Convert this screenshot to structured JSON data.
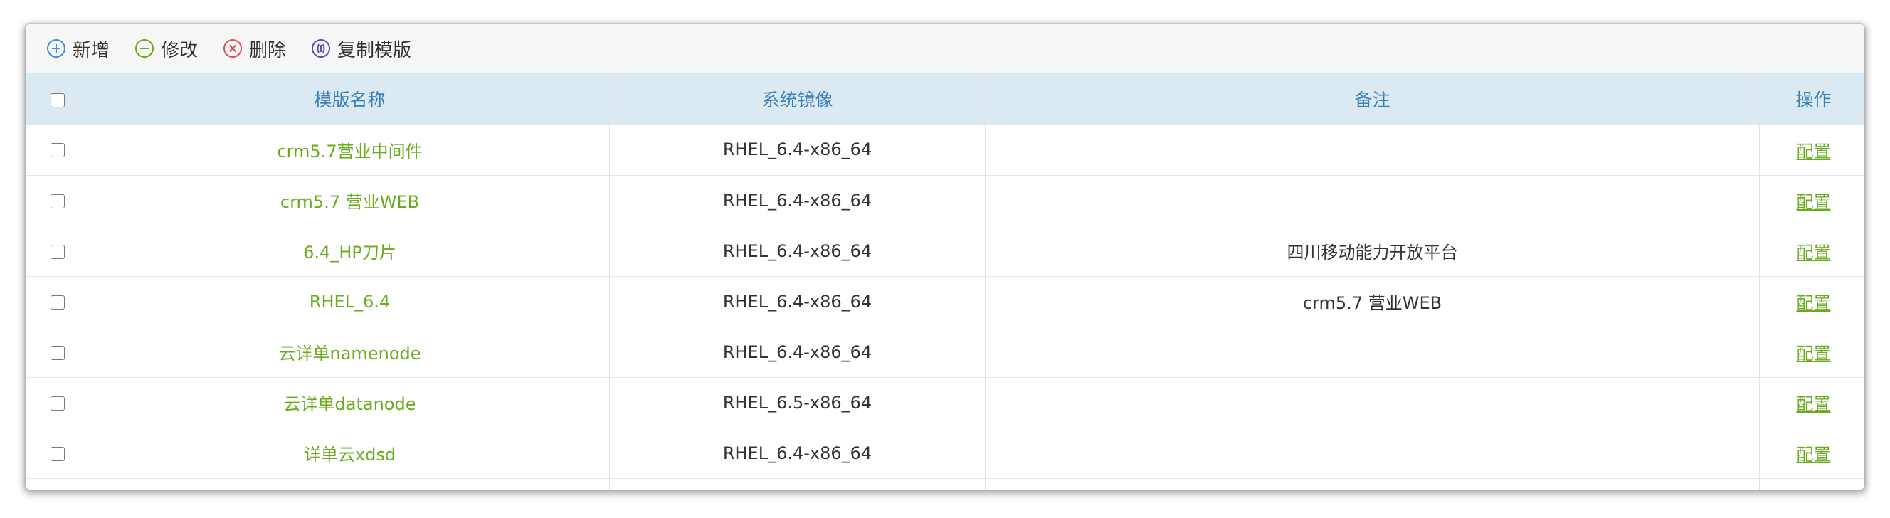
{
  "toolbar": {
    "add_label": "新增",
    "edit_label": "修改",
    "delete_label": "删除",
    "copy_label": "复制模版"
  },
  "colors": {
    "add": "#3b8fd8",
    "edit": "#6aab1e",
    "delete": "#d9534f",
    "copy": "#5b4fa8",
    "header_bg": "#dbe9f3",
    "header_text": "#3a7fb5",
    "link": "#6aab1e"
  },
  "table": {
    "headers": {
      "name": "模版名称",
      "image": "系统镜像",
      "remark": "备注",
      "action": "操作"
    },
    "rows": [
      {
        "name": "crm5.7营业中间件",
        "image": "RHEL_6.4-x86_64",
        "remark": "",
        "action": "配置"
      },
      {
        "name": "crm5.7 营业WEB",
        "image": "RHEL_6.4-x86_64",
        "remark": "",
        "action": "配置"
      },
      {
        "name": "6.4_HP刀片",
        "image": "RHEL_6.4-x86_64",
        "remark": "四川移动能力开放平台",
        "action": "配置"
      },
      {
        "name": "RHEL_6.4",
        "image": "RHEL_6.4-x86_64",
        "remark": "crm5.7 营业WEB",
        "action": "配置"
      },
      {
        "name": "云详单namenode",
        "image": "RHEL_6.4-x86_64",
        "remark": "",
        "action": "配置"
      },
      {
        "name": "云详单datanode",
        "image": "RHEL_6.5-x86_64",
        "remark": "",
        "action": "配置"
      },
      {
        "name": "详单云xdsd",
        "image": "RHEL_6.4-x86_64",
        "remark": "",
        "action": "配置"
      },
      {
        "name": "",
        "image": "",
        "remark": "",
        "action": ""
      }
    ]
  }
}
